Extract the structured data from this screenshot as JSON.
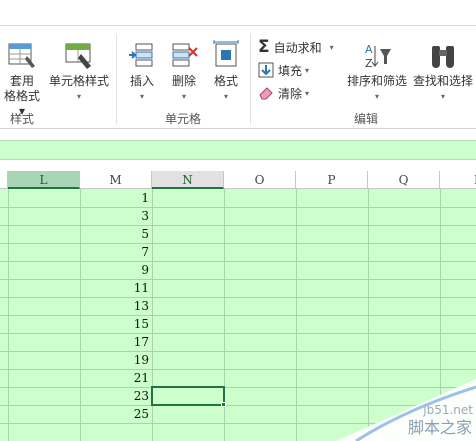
{
  "ribbon": {
    "styles_group": {
      "table_format_line1": "套用",
      "table_format_line2": "格格式 ▾",
      "cell_styles_label": "单元格样式",
      "group_label": "样式"
    },
    "cells_group": {
      "insert_label": "插入",
      "delete_label": "删除",
      "format_label": "格式",
      "group_label": "单元格"
    },
    "editing_group": {
      "autosum_label": "自动求和",
      "fill_label": "填充",
      "clear_label": "清除",
      "sort_filter_label": "排序和筛选",
      "find_select_label": "查找和选择",
      "group_label": "编辑"
    }
  },
  "sheet": {
    "columns": [
      "L",
      "M",
      "N",
      "O",
      "P",
      "Q",
      "R"
    ],
    "selected_column": "L",
    "active_column": "N",
    "m_values": [
      "1",
      "3",
      "5",
      "7",
      "9",
      "11",
      "13",
      "15",
      "17",
      "19",
      "21",
      "23",
      "25"
    ],
    "active_cell_row": 12
  },
  "colors": {
    "sheet_fill": "#ccffcc",
    "accent": "#217346",
    "selected_header": "#a8d5b4"
  },
  "watermark": {
    "url": "jb51.net",
    "site_cn": "脚本之家"
  }
}
